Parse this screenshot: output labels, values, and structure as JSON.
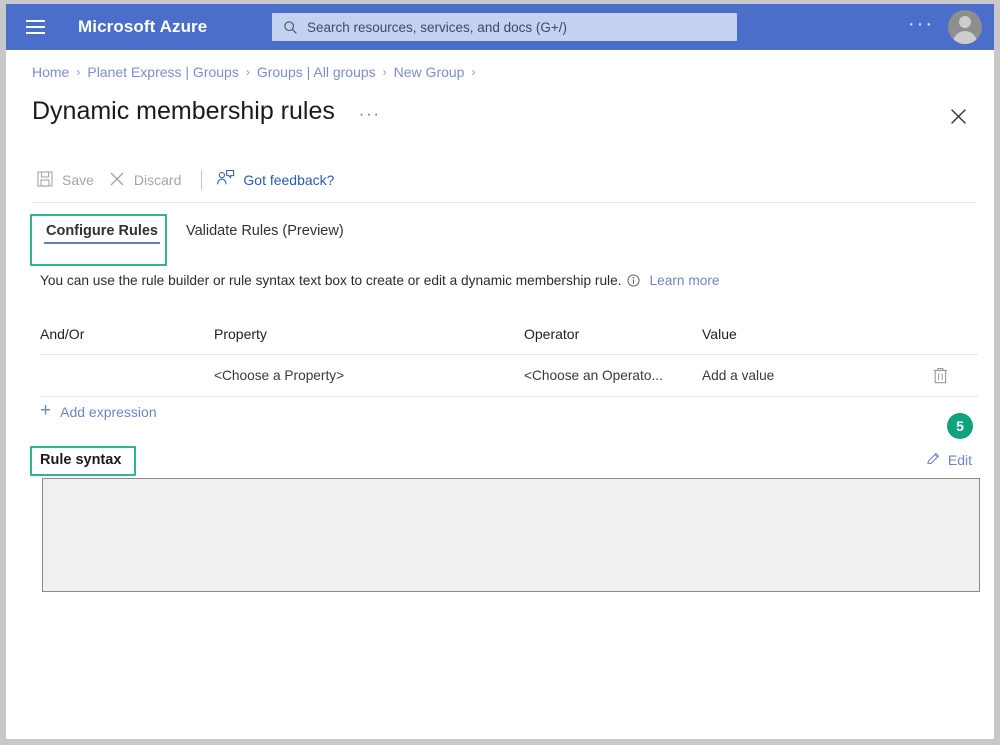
{
  "topbar": {
    "menu_icon": "hamburger-icon",
    "brand": "Microsoft Azure",
    "search": {
      "icon": "search-icon",
      "placeholder": "Search resources, services, and docs (G+/)",
      "value": ""
    },
    "more_label": "···",
    "account_icon": "user-avatar-icon",
    "background_color": "#4a6ec9"
  },
  "breadcrumb": {
    "separator": "›",
    "items": [
      "Home",
      "Planet Express | Groups",
      "Groups | All groups",
      "New Group"
    ]
  },
  "blade": {
    "title": "Dynamic membership rules",
    "title_more_label": "···",
    "close_icon": "close-icon"
  },
  "command_bar": {
    "save": {
      "label": "Save",
      "icon": "save-disk-icon",
      "enabled": false
    },
    "discard": {
      "label": "Discard",
      "icon": "close-x-icon",
      "enabled": false
    },
    "feedback": {
      "label": "Got feedback?",
      "icon": "person-feedback-icon",
      "enabled": true
    }
  },
  "tabs": [
    {
      "label": "Configure Rules",
      "selected": true
    },
    {
      "label": "Validate Rules (Preview)",
      "selected": false
    }
  ],
  "description": {
    "text": "You can use the rule builder or rule syntax text box to create or edit a dynamic membership rule.",
    "info_icon": "info-circle-icon",
    "link_label": "Learn more"
  },
  "rules_table": {
    "columns": [
      "And/Or",
      "Property",
      "Operator",
      "Value"
    ],
    "rows": [
      {
        "and_or": "",
        "property": "<Choose a Property>",
        "operator": "<Choose an Operato...",
        "value": "Add a value",
        "delete_icon": "trash-icon"
      }
    ]
  },
  "add_expression": {
    "label": "Add expression",
    "icon": "plus-icon"
  },
  "step_badge": {
    "number": "5",
    "color": "#11a37f"
  },
  "edit_action": {
    "label": "Edit",
    "icon": "pencil-edit-icon"
  },
  "rule_syntax": {
    "label": "Rule syntax",
    "value": "",
    "placeholder": ""
  },
  "highlight_color": "#2cb693"
}
